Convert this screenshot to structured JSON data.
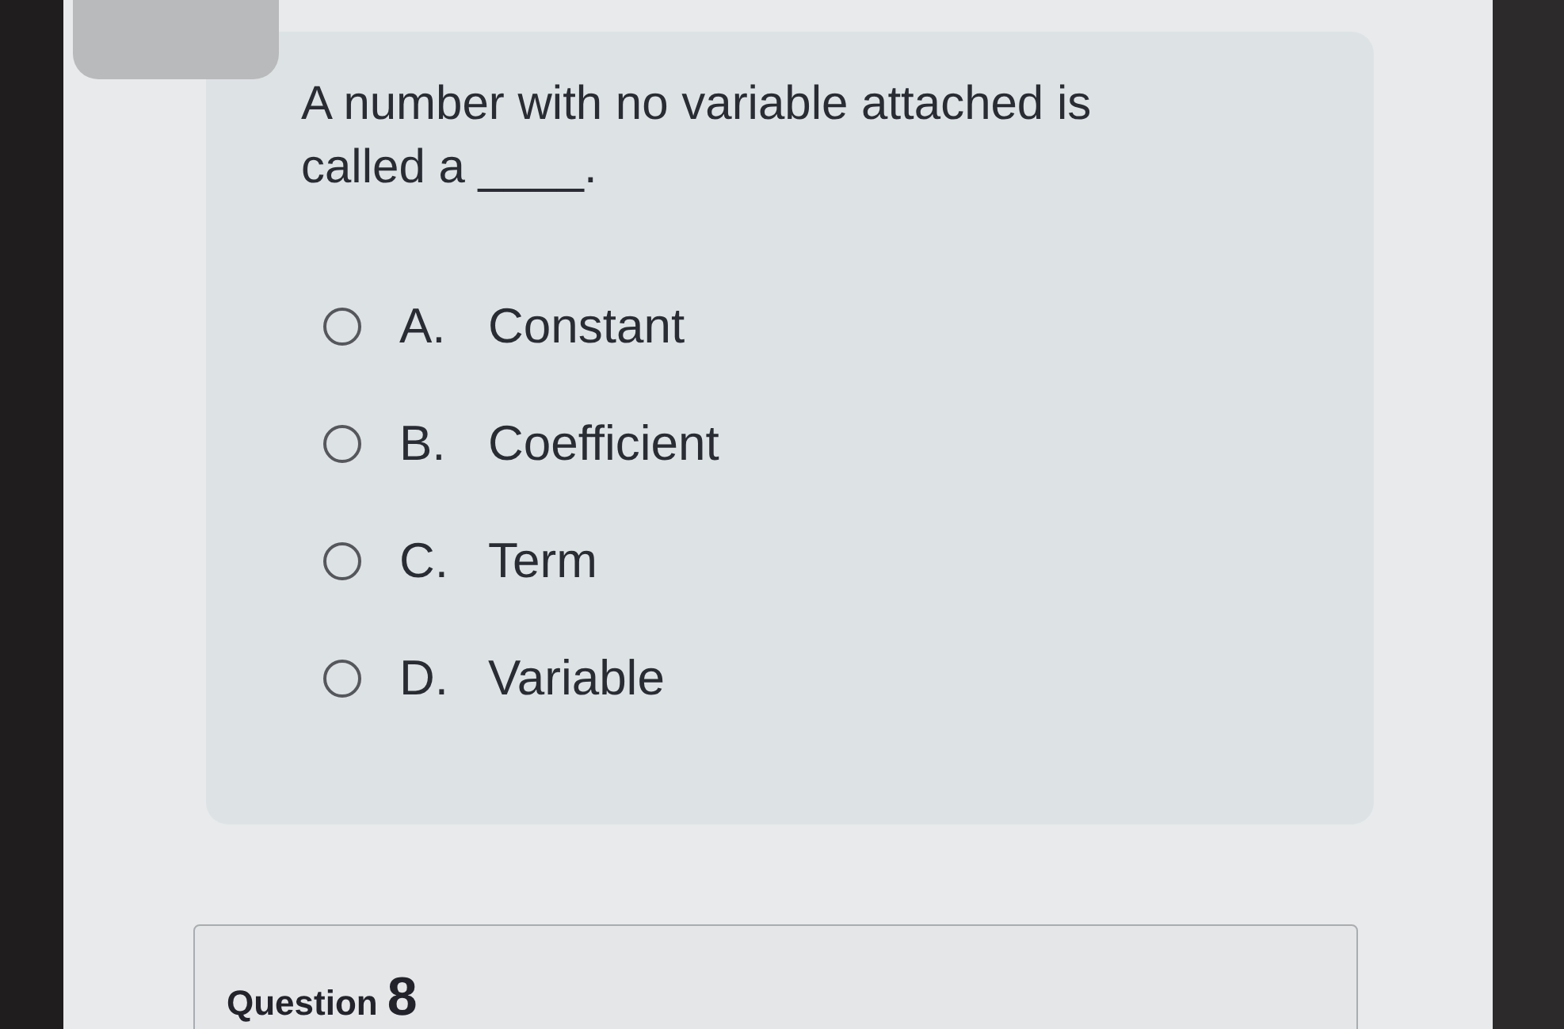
{
  "question": {
    "prompt": "A number with no variable attached is called a ____.",
    "options": [
      {
        "letter": "A.",
        "text": "Constant",
        "selected": false
      },
      {
        "letter": "B.",
        "text": "Coefficient",
        "selected": false
      },
      {
        "letter": "C.",
        "text": "Term",
        "selected": false
      },
      {
        "letter": "D.",
        "text": "Variable",
        "selected": false
      }
    ]
  },
  "next_question": {
    "label": "Question",
    "number": "8"
  }
}
